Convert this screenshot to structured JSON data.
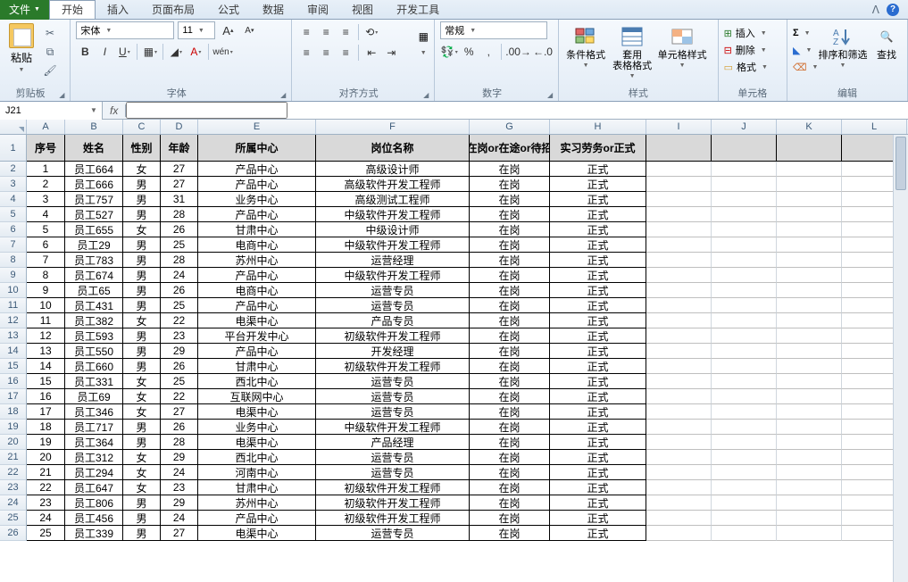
{
  "tabs": {
    "file": "文件",
    "items": [
      "开始",
      "插入",
      "页面布局",
      "公式",
      "数据",
      "审阅",
      "视图",
      "开发工具"
    ],
    "active": 0
  },
  "ribbon": {
    "clipboard": {
      "paste": "粘贴",
      "label": "剪贴板"
    },
    "font": {
      "family": "宋体",
      "size": "11",
      "label": "字体"
    },
    "align": {
      "label": "对齐方式"
    },
    "number": {
      "format": "常规",
      "label": "数字"
    },
    "styles": {
      "cond": "条件格式",
      "tablefmt": "套用\n表格格式",
      "cellstyle": "单元格样式",
      "label": "样式"
    },
    "cells": {
      "insert": "插入",
      "delete": "删除",
      "format": "格式",
      "label": "单元格"
    },
    "editing": {
      "sort": "排序和筛选",
      "find": "查找",
      "label": "编辑"
    }
  },
  "namebox": "J21",
  "formula": "",
  "columns": [
    "A",
    "B",
    "C",
    "D",
    "E",
    "F",
    "G",
    "H",
    "I",
    "J",
    "K",
    "L"
  ],
  "headers": [
    "序号",
    "姓名",
    "性别",
    "年龄",
    "所属中心",
    "岗位名称",
    "在岗or在途or待招",
    "实习劳务or正式"
  ],
  "rows": [
    {
      "n": 1,
      "d": [
        "1",
        "员工664",
        "女",
        "27",
        "产品中心",
        "高级设计师",
        "在岗",
        "正式"
      ]
    },
    {
      "n": 2,
      "d": [
        "2",
        "员工666",
        "男",
        "27",
        "产品中心",
        "高级软件开发工程师",
        "在岗",
        "正式"
      ]
    },
    {
      "n": 3,
      "d": [
        "3",
        "员工757",
        "男",
        "31",
        "业务中心",
        "高级测试工程师",
        "在岗",
        "正式"
      ]
    },
    {
      "n": 4,
      "d": [
        "4",
        "员工527",
        "男",
        "28",
        "产品中心",
        "中级软件开发工程师",
        "在岗",
        "正式"
      ]
    },
    {
      "n": 5,
      "d": [
        "5",
        "员工655",
        "女",
        "26",
        "甘肃中心",
        "中级设计师",
        "在岗",
        "正式"
      ]
    },
    {
      "n": 6,
      "d": [
        "6",
        "员工29",
        "男",
        "25",
        "电商中心",
        "中级软件开发工程师",
        "在岗",
        "正式"
      ]
    },
    {
      "n": 7,
      "d": [
        "7",
        "员工783",
        "男",
        "28",
        "苏州中心",
        "运营经理",
        "在岗",
        "正式"
      ]
    },
    {
      "n": 8,
      "d": [
        "8",
        "员工674",
        "男",
        "24",
        "产品中心",
        "中级软件开发工程师",
        "在岗",
        "正式"
      ]
    },
    {
      "n": 9,
      "d": [
        "9",
        "员工65",
        "男",
        "26",
        "电商中心",
        "运营专员",
        "在岗",
        "正式"
      ]
    },
    {
      "n": 10,
      "d": [
        "10",
        "员工431",
        "男",
        "25",
        "产品中心",
        "运营专员",
        "在岗",
        "正式"
      ]
    },
    {
      "n": 11,
      "d": [
        "11",
        "员工382",
        "女",
        "22",
        "电渠中心",
        "产品专员",
        "在岗",
        "正式"
      ]
    },
    {
      "n": 12,
      "d": [
        "12",
        "员工593",
        "男",
        "23",
        "平台开发中心",
        "初级软件开发工程师",
        "在岗",
        "正式"
      ]
    },
    {
      "n": 13,
      "d": [
        "13",
        "员工550",
        "男",
        "29",
        "产品中心",
        "开发经理",
        "在岗",
        "正式"
      ]
    },
    {
      "n": 14,
      "d": [
        "14",
        "员工660",
        "男",
        "26",
        "甘肃中心",
        "初级软件开发工程师",
        "在岗",
        "正式"
      ]
    },
    {
      "n": 15,
      "d": [
        "15",
        "员工331",
        "女",
        "25",
        "西北中心",
        "运营专员",
        "在岗",
        "正式"
      ]
    },
    {
      "n": 16,
      "d": [
        "16",
        "员工69",
        "女",
        "22",
        "互联网中心",
        "运营专员",
        "在岗",
        "正式"
      ]
    },
    {
      "n": 17,
      "d": [
        "17",
        "员工346",
        "女",
        "27",
        "电渠中心",
        "运营专员",
        "在岗",
        "正式"
      ]
    },
    {
      "n": 18,
      "d": [
        "18",
        "员工717",
        "男",
        "26",
        "业务中心",
        "中级软件开发工程师",
        "在岗",
        "正式"
      ]
    },
    {
      "n": 19,
      "d": [
        "19",
        "员工364",
        "男",
        "28",
        "电渠中心",
        "产品经理",
        "在岗",
        "正式"
      ]
    },
    {
      "n": 20,
      "d": [
        "20",
        "员工312",
        "女",
        "29",
        "西北中心",
        "运营专员",
        "在岗",
        "正式"
      ]
    },
    {
      "n": 21,
      "d": [
        "21",
        "员工294",
        "女",
        "24",
        "河南中心",
        "运营专员",
        "在岗",
        "正式"
      ]
    },
    {
      "n": 22,
      "d": [
        "22",
        "员工647",
        "女",
        "23",
        "甘肃中心",
        "初级软件开发工程师",
        "在岗",
        "正式"
      ]
    },
    {
      "n": 23,
      "d": [
        "23",
        "员工806",
        "男",
        "29",
        "苏州中心",
        "初级软件开发工程师",
        "在岗",
        "正式"
      ]
    },
    {
      "n": 24,
      "d": [
        "24",
        "员工456",
        "男",
        "24",
        "产品中心",
        "初级软件开发工程师",
        "在岗",
        "正式"
      ]
    },
    {
      "n": 25,
      "d": [
        "25",
        "员工339",
        "男",
        "27",
        "电渠中心",
        "运营专员",
        "在岗",
        "正式"
      ]
    }
  ]
}
